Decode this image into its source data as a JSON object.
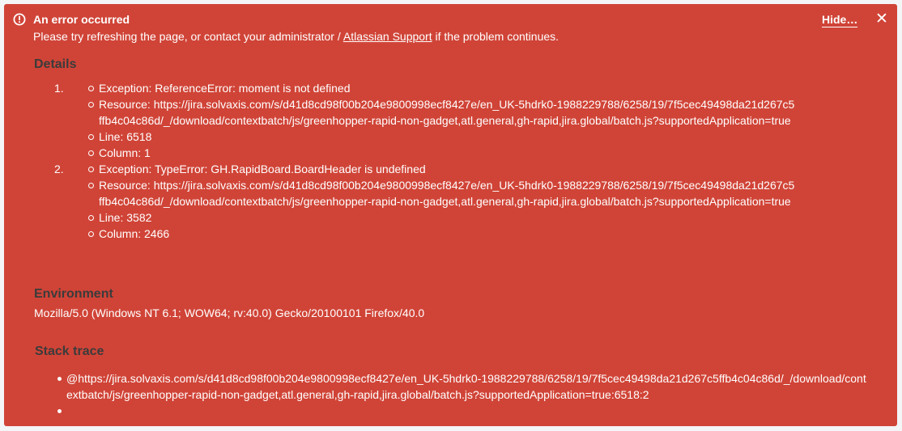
{
  "alert": {
    "icon": "exclamation-circle-icon",
    "title": "An error occurred",
    "message_before_link": "Please try refreshing the page, or contact your administrator / ",
    "support_link": "Atlassian Support",
    "message_after_link": " if the problem continues.",
    "hide_label": "Hide…",
    "close_icon": "close-icon",
    "close_glyph": "✕",
    "background_color": "#d04437",
    "heading_color": "#3b3b3b"
  },
  "details": {
    "heading": "Details",
    "exceptions": [
      {
        "number": "1.",
        "exception": "Exception: ReferenceError: moment is not defined",
        "resource": "Resource: https://jira.solvaxis.com/s/d41d8cd98f00b204e9800998ecf8427e/en_UK-5hdrk0-1988229788/6258/19/7f5cec49498da21d267c5ffb4c04c86d/_/download/contextbatch/js/greenhopper-rapid-non-gadget,atl.general,gh-rapid,jira.global/batch.js?supportedApplication=true",
        "line": "Line: 6518",
        "column": "Column: 1"
      },
      {
        "number": "2.",
        "exception": "Exception: TypeError: GH.RapidBoard.BoardHeader is undefined",
        "resource": "Resource: https://jira.solvaxis.com/s/d41d8cd98f00b204e9800998ecf8427e/en_UK-5hdrk0-1988229788/6258/19/7f5cec49498da21d267c5ffb4c04c86d/_/download/contextbatch/js/greenhopper-rapid-non-gadget,atl.general,gh-rapid,jira.global/batch.js?supportedApplication=true",
        "line": "Line: 3582",
        "column": "Column: 2466"
      }
    ]
  },
  "environment": {
    "heading": "Environment",
    "user_agent": "Mozilla/5.0 (Windows NT 6.1; WOW64; rv:40.0) Gecko/20100101 Firefox/40.0"
  },
  "stack_trace": {
    "heading": "Stack trace",
    "entries": [
      "@https://jira.solvaxis.com/s/d41d8cd98f00b204e9800998ecf8427e/en_UK-5hdrk0-1988229788/6258/19/7f5cec49498da21d267c5ffb4c04c86d/_/download/contextbatch/js/greenhopper-rapid-non-gadget,atl.general,gh-rapid,jira.global/batch.js?supportedApplication=true:6518:2",
      ""
    ]
  }
}
